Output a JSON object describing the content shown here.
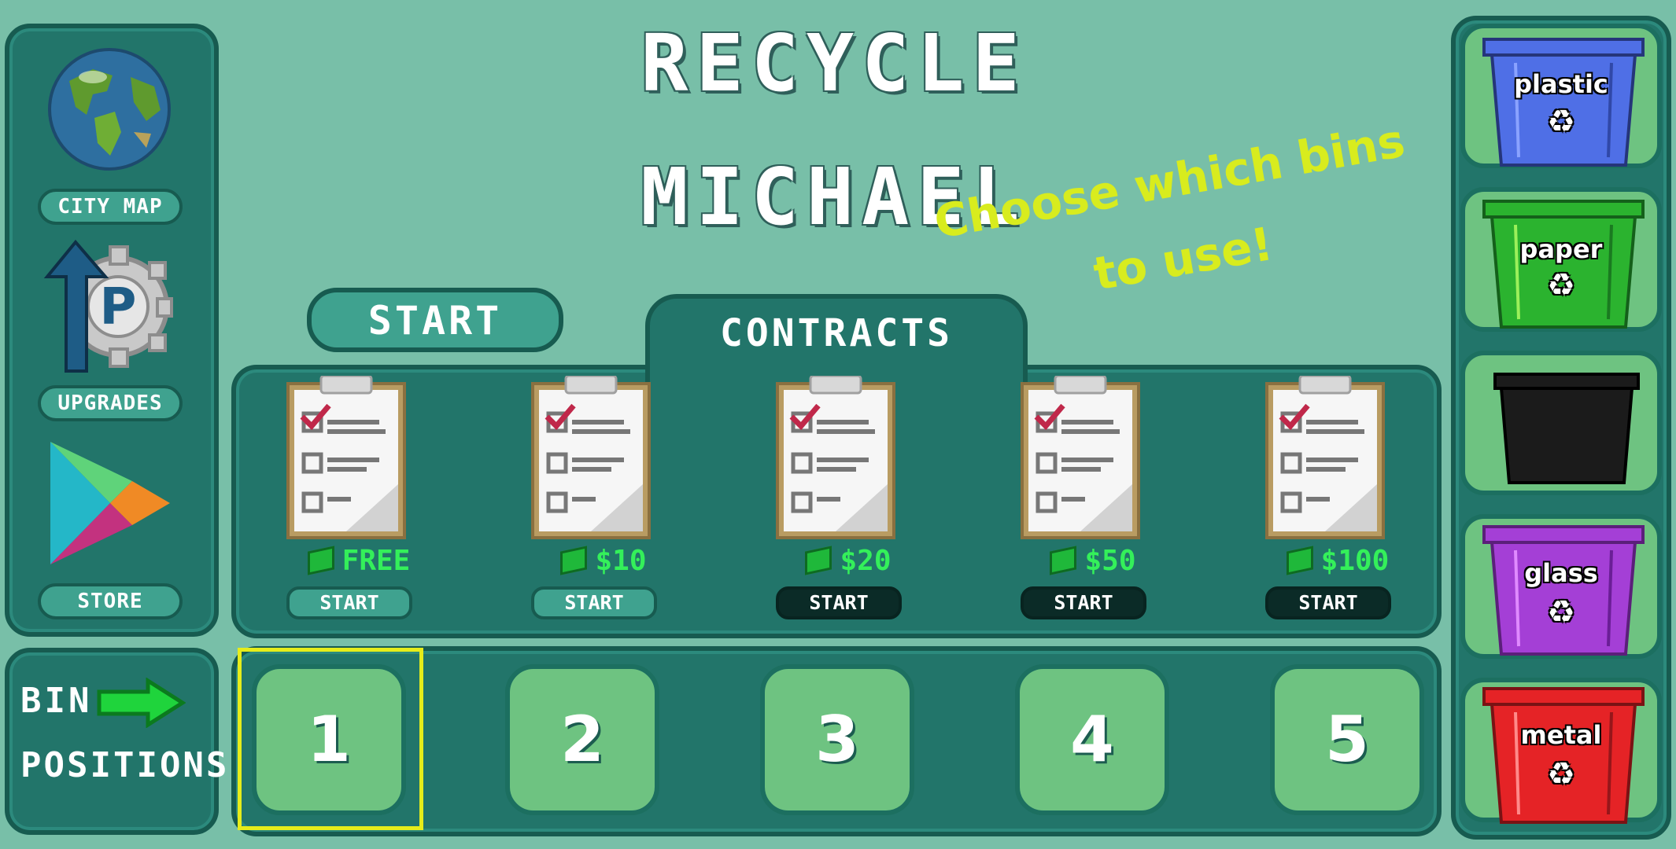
{
  "title": {
    "line1": "RECYCLE",
    "line2": "MICHAEL"
  },
  "hint": {
    "text": "Choose which bins to use!"
  },
  "sidebar": {
    "city_map_label": "CITY MAP",
    "upgrades_label": "UPGRADES",
    "store_label": "STORE"
  },
  "start_button": {
    "label": "START"
  },
  "contracts": {
    "tab_label": "CONTRACTS",
    "items": [
      {
        "price": "FREE",
        "button": "START",
        "state": "active"
      },
      {
        "price": "$10",
        "button": "START",
        "state": "active"
      },
      {
        "price": "$20",
        "button": "START",
        "state": "locked"
      },
      {
        "price": "$50",
        "button": "START",
        "state": "locked"
      },
      {
        "price": "$100",
        "button": "START",
        "state": "locked"
      }
    ]
  },
  "bin_positions": {
    "label_line1": "BIN",
    "label_line2": "POSITIONS",
    "slots": [
      "1",
      "2",
      "3",
      "4",
      "5"
    ],
    "selected_slot": "1"
  },
  "bins": [
    {
      "label": "plastic",
      "color": "#4f6fe6"
    },
    {
      "label": "paper",
      "color": "#2bb32f"
    },
    {
      "label": "",
      "color": "#1b1b1b"
    },
    {
      "label": "glass",
      "color": "#a43fd6"
    },
    {
      "label": "metal",
      "color": "#e52326"
    }
  ],
  "colors": {
    "background": "#78bfa8",
    "panel": "#22756a",
    "hint": "#d8ec1e",
    "price_green": "#34f05a",
    "selection_outline": "#e6ec1a"
  }
}
